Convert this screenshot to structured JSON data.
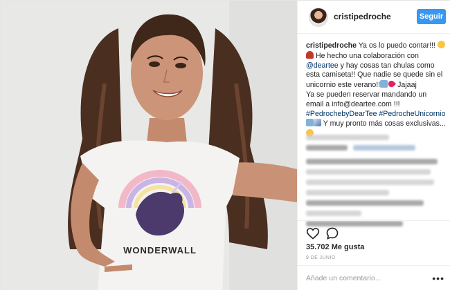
{
  "post": {
    "username": "cristipedroche",
    "follow_label": "Seguir",
    "caption": {
      "author": "cristipedroche",
      "p1": " Ya os lo puedo contar!!!",
      "p2": " He hecho una colaboración con ",
      "mention": "@deartee",
      "p3": " y hay cosas tan chulas como esta camiseta!! Que nadie se quede sin el unicornio este verano!!",
      "p4": " Jajaaj",
      "p5": "Ya se pueden reservar mandando un email a info@deartee.com !!!",
      "hashtags": "#PedrochebyDearTee #PedrocheUnicornio",
      "p6": " Y muy pronto más cosas exclusivas..."
    },
    "likes": "35.702 Me gusta",
    "date": "9 DE JUNIO",
    "comment_placeholder": "Añade un comentario...",
    "options_label": "•••",
    "shirt_text": "WONDERWALL"
  },
  "icons": [
    "heart-icon",
    "comment-icon",
    "more-options-icon"
  ],
  "colors": {
    "follow_button": "#3897f0",
    "link": "#003569",
    "border": "#efefef"
  }
}
